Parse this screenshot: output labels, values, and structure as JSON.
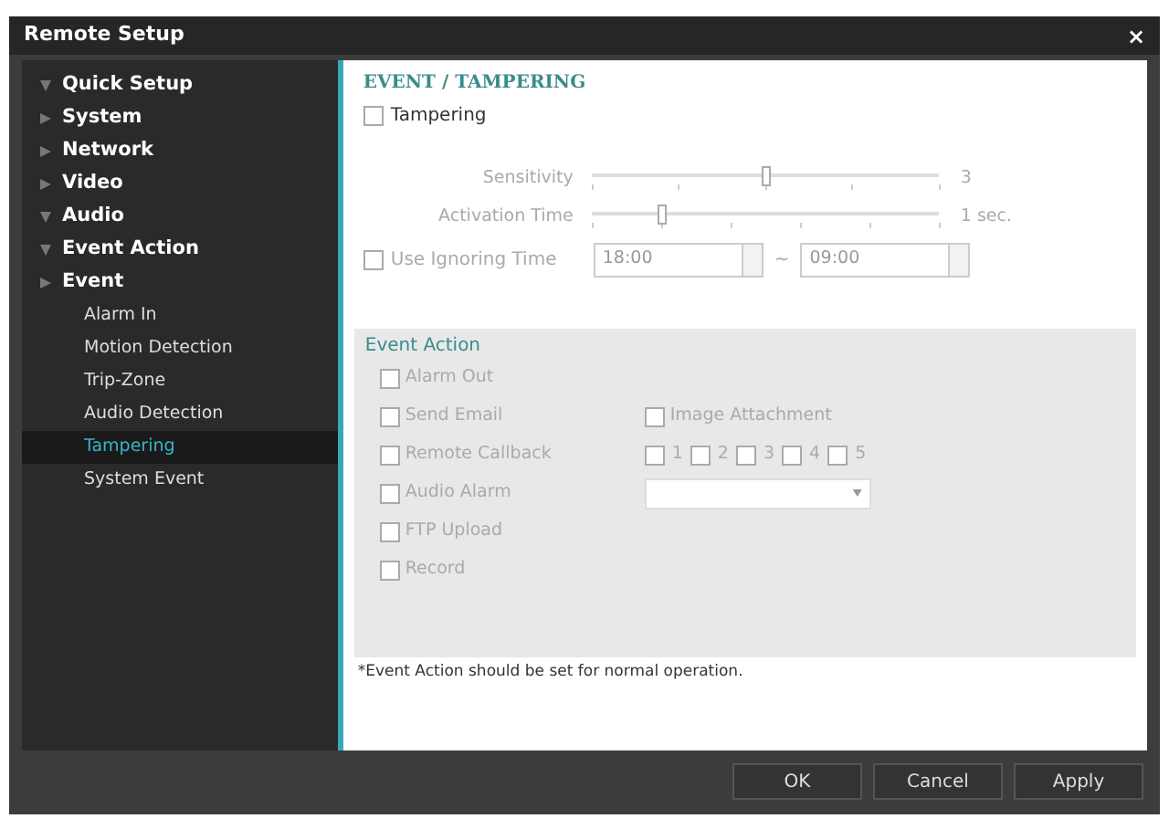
{
  "window": {
    "title": "Remote Setup",
    "close": "×"
  },
  "sidebar": {
    "items": [
      {
        "label": "Quick Setup",
        "expanded": true,
        "selected": false
      },
      {
        "label": "System",
        "expanded": false,
        "selected": false
      },
      {
        "label": "Network",
        "expanded": false,
        "selected": false
      },
      {
        "label": "Video",
        "expanded": false,
        "selected": false
      },
      {
        "label": "Audio",
        "expanded": true,
        "selected": false
      },
      {
        "label": "Event Action",
        "expanded": true,
        "selected": false
      },
      {
        "label": "Event",
        "expanded": false,
        "selected": false,
        "children": [
          {
            "label": "Alarm In",
            "selected": false
          },
          {
            "label": "Motion Detection",
            "selected": false
          },
          {
            "label": "Trip-Zone",
            "selected": false
          },
          {
            "label": "Audio Detection",
            "selected": false
          },
          {
            "label": "Tampering",
            "selected": true
          },
          {
            "label": "System Event",
            "selected": false
          }
        ]
      }
    ]
  },
  "content": {
    "title": "EVENT / TAMPERING",
    "tampering": {
      "label": "Tampering",
      "checked": false
    },
    "sliders": [
      {
        "label": "Sensitivity",
        "level": 0.5,
        "reading": "3"
      },
      {
        "label": "Activation Time",
        "level": 0.2,
        "reading": "1 sec."
      }
    ],
    "ignoring": {
      "label": "Use Ignoring Time",
      "checked": false,
      "from": "18:00",
      "separator": "~",
      "to": "09:00"
    },
    "event_action": {
      "title": "Event Action",
      "rows": [
        {
          "kind": "plain",
          "label": "Alarm Out",
          "checked": false
        },
        {
          "kind": "attachment",
          "label": "Send Email",
          "checked": false,
          "extra": {
            "label": "Image Attachment",
            "checked": false
          }
        },
        {
          "kind": "numbers",
          "label": "Remote Callback",
          "checked": false,
          "options": [
            {
              "label": "1",
              "checked": false
            },
            {
              "label": "2",
              "checked": false
            },
            {
              "label": "3",
              "checked": false
            },
            {
              "label": "4",
              "checked": false
            },
            {
              "label": "5",
              "checked": false
            }
          ]
        },
        {
          "kind": "dropdown",
          "label": "Audio Alarm",
          "checked": false
        },
        {
          "kind": "plain",
          "label": "FTP Upload",
          "checked": false
        },
        {
          "kind": "plain",
          "label": "Record",
          "checked": false
        }
      ]
    },
    "note": "*Event Action should be set for normal operation."
  },
  "buttons": [
    "OK",
    "Cancel",
    "Apply"
  ]
}
